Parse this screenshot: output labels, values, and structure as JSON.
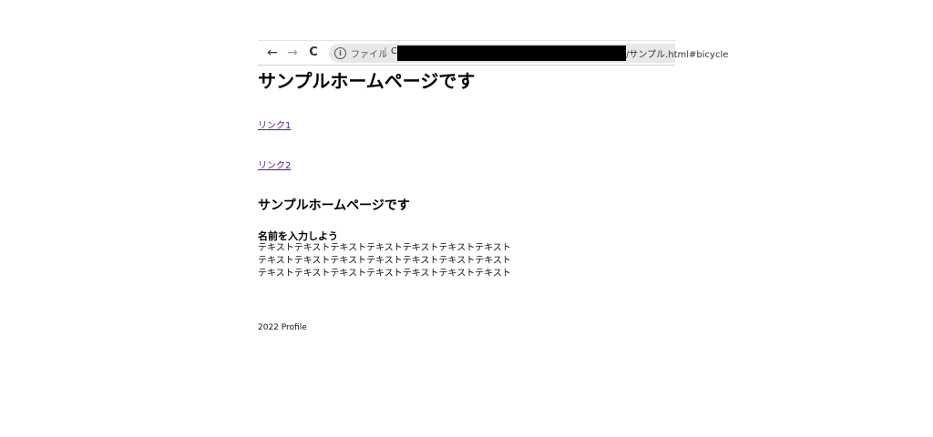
{
  "browser": {
    "back_glyph": "←",
    "forward_glyph": "→",
    "reload_glyph": "C",
    "info_glyph": "i",
    "scheme_label": "ファイル",
    "separator": "|",
    "drive": "C",
    "path_suffix": "/サンプル.html#bicycle",
    "icons": [
      "back-arrow-icon",
      "forward-arrow-icon",
      "reload-icon",
      "info-icon"
    ]
  },
  "page": {
    "title": "サンプルホームページです",
    "links": [
      {
        "label": "リンク1"
      },
      {
        "label": "リンク2"
      }
    ],
    "section_heading": "サンプルホームページです",
    "sub_heading": "名前を入力しよう",
    "body_lines": [
      "テキストテキストテキストテキストテキストテキストテキスト",
      "テキストテキストテキストテキストテキストテキストテキスト",
      "テキストテキストテキストテキストテキストテキストテキスト"
    ],
    "footer": "2022 Profile"
  },
  "colors": {
    "link_visited": "#551a8b",
    "address_bar_bg": "#e8e8e8",
    "redaction": "#000000"
  }
}
